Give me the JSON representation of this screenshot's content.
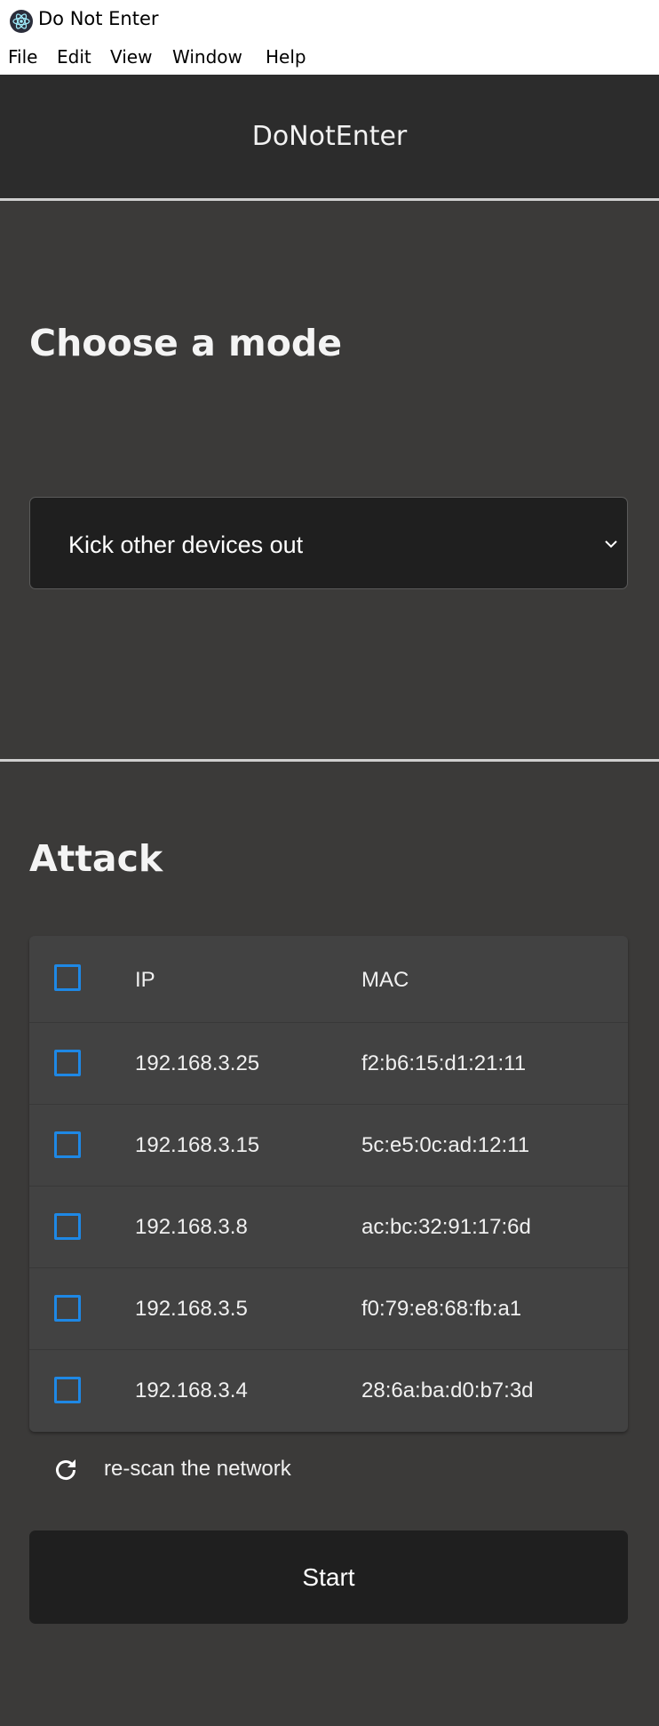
{
  "window": {
    "title": "Do Not Enter",
    "menu": [
      "File",
      "Edit",
      "View",
      "Window",
      "Help"
    ]
  },
  "header": {
    "app_name": "DoNotEnter"
  },
  "mode_section": {
    "title": "Choose a mode",
    "selected_mode": "Kick other devices out"
  },
  "attack_section": {
    "title": "Attack",
    "columns": [
      "IP",
      "MAC"
    ],
    "devices": [
      {
        "ip": "192.168.3.25",
        "mac": "f2:b6:15:d1:21:11",
        "checked": false
      },
      {
        "ip": "192.168.3.15",
        "mac": "5c:e5:0c:ad:12:11",
        "checked": false
      },
      {
        "ip": "192.168.3.8",
        "mac": "ac:bc:32:91:17:6d",
        "checked": false
      },
      {
        "ip": "192.168.3.5",
        "mac": "f0:79:e8:68:fb:a1",
        "checked": false
      },
      {
        "ip": "192.168.3.4",
        "mac": "28:6a:ba:d0:b7:3d",
        "checked": false
      }
    ],
    "rescan_label": "re-scan the network",
    "start_label": "Start"
  },
  "colors": {
    "accent": "#1e88e5",
    "background": "#3b3a39",
    "header_bg": "#2c2c2c",
    "control_bg": "#1f1f1f"
  },
  "icons": {
    "app": "electron-atom-icon",
    "dropdown": "chevron-down-icon",
    "rescan": "refresh-icon"
  }
}
